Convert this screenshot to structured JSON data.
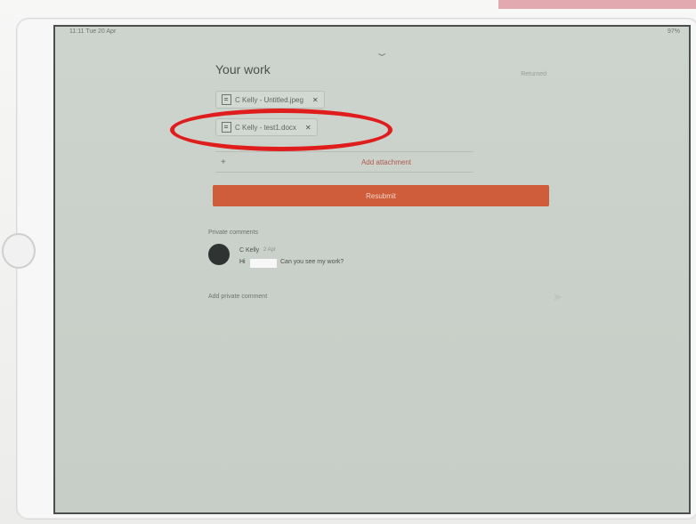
{
  "status_bar": {
    "time": "11:11  Tue 20 Apr",
    "right": "97%"
  },
  "header": {
    "title": "Your work",
    "status": "Returned"
  },
  "attachments": [
    {
      "label": "C Kelly - Untitled.jpeg"
    },
    {
      "label": "C Kelly - test1.docx"
    }
  ],
  "add_attachment_label": "Add attachment",
  "resubmit_label": "Resubmit",
  "private_comments": {
    "heading": "Private comments",
    "comment": {
      "author": "C Kelly",
      "time": "2 Apr",
      "greeting": "Hi",
      "text": "Can you see my work?"
    }
  },
  "add_comment_label": "Add private comment",
  "colors": {
    "accent": "#cf5d3c",
    "highlight": "#e01d1d"
  },
  "icons": [
    "file-icon",
    "close-icon",
    "plus-icon",
    "avatar",
    "send-icon",
    "chevron-down-icon"
  ]
}
